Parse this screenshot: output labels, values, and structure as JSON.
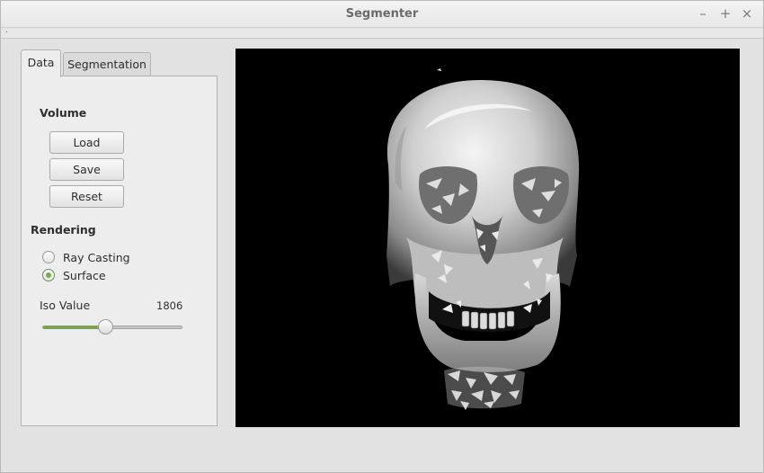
{
  "window": {
    "title": "Segmenter",
    "minimize_icon": "minimize-icon",
    "maximize_icon": "maximize-icon",
    "close_icon": "close-icon",
    "minimize_glyph": "–",
    "maximize_glyph": "+",
    "close_glyph": "×"
  },
  "menubar": {
    "text": "."
  },
  "tabs": [
    {
      "label": "Data",
      "active": true
    },
    {
      "label": "Segmentation",
      "active": false
    }
  ],
  "volume": {
    "heading": "Volume",
    "load_label": "Load",
    "save_label": "Save",
    "reset_label": "Reset"
  },
  "rendering": {
    "heading": "Rendering",
    "options": [
      {
        "label": "Ray Casting",
        "checked": false
      },
      {
        "label": "Surface",
        "checked": true
      }
    ]
  },
  "iso": {
    "label": "Iso Value",
    "value": "1806",
    "slider_fraction": 0.45
  },
  "viewport": {
    "content": "3D skull surface rendering"
  },
  "colors": {
    "accent_green": "#7ba159",
    "viewport_bg": "#000000"
  }
}
